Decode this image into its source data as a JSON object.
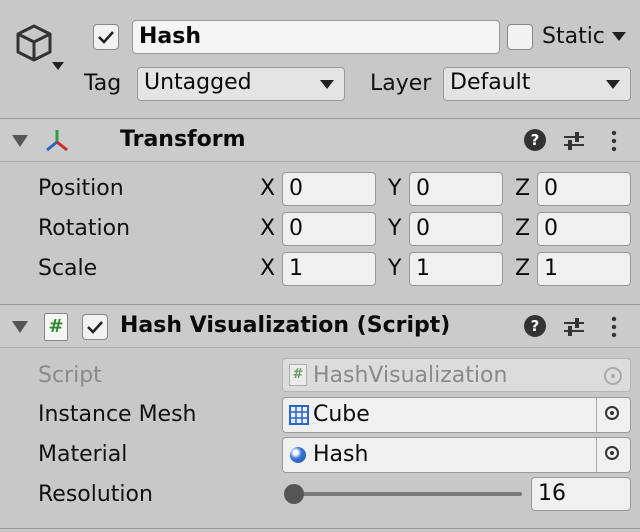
{
  "header": {
    "name": "Hash",
    "static_label": "Static",
    "tag_label": "Tag",
    "tag_value": "Untagged",
    "layer_label": "Layer",
    "layer_value": "Default"
  },
  "transform": {
    "title": "Transform",
    "rows": [
      {
        "label": "Position",
        "x": "0",
        "y": "0",
        "z": "0"
      },
      {
        "label": "Rotation",
        "x": "0",
        "y": "0",
        "z": "0"
      },
      {
        "label": "Scale",
        "x": "1",
        "y": "1",
        "z": "1"
      }
    ],
    "axis_x": "X",
    "axis_y": "Y",
    "axis_z": "Z"
  },
  "script_component": {
    "title": "Hash Visualization (Script)",
    "script_label": "Script",
    "script_value": "HashVisualization",
    "mesh_label": "Instance Mesh",
    "mesh_value": "Cube",
    "material_label": "Material",
    "material_value": "Hash",
    "resolution_label": "Resolution",
    "resolution_value": "16"
  },
  "icons": [
    "cube-icon",
    "transform-axes-icon",
    "help-icon",
    "preset-sliders-icon",
    "more-vert-icon",
    "script-hash-icon",
    "mesh-grid-icon",
    "material-sphere-icon",
    "object-picker-icon"
  ]
}
